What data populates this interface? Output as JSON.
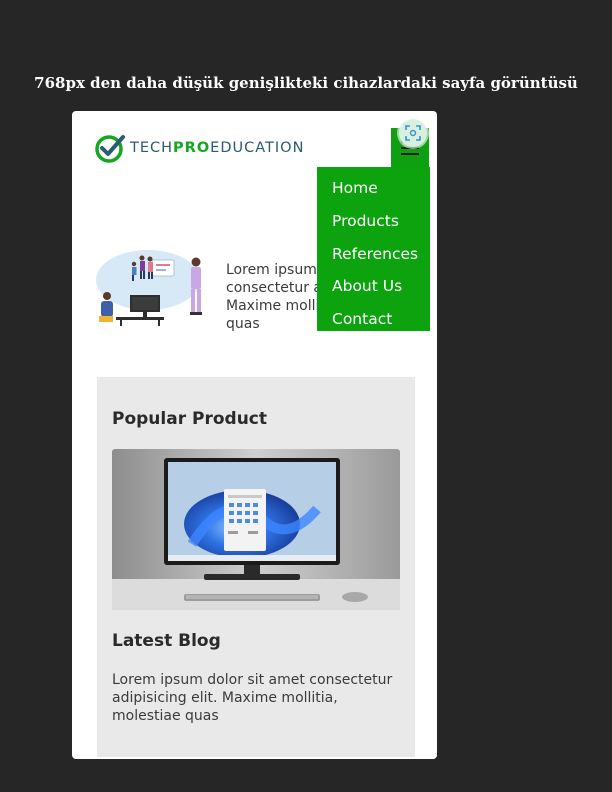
{
  "caption": "768px den daha düşük genişlikteki cihazlardaki sayfa görüntüsü",
  "logo": {
    "part1": "TECH",
    "part2": "PRO",
    "part3": "EDUCATION"
  },
  "colors": {
    "accent": "#0ca30f",
    "page_bg": "#262626",
    "card_bg": "#e9e9e9"
  },
  "icons": {
    "menu": "hamburger-icon",
    "logo": "check-circle-icon",
    "overlay": "scan-icon"
  },
  "menu": {
    "items": [
      {
        "label": "Home"
      },
      {
        "label": "Products"
      },
      {
        "label": "References"
      },
      {
        "label": "About Us"
      },
      {
        "label": "Contact"
      }
    ]
  },
  "hero": {
    "text": "Lorem ipsum dolor sit amet consectetur adipisicing elit. Maxime mollitia, molestiae quas"
  },
  "product": {
    "title": "Popular Product"
  },
  "blog": {
    "title": "Latest Blog",
    "text": "Lorem ipsum dolor sit amet consectetur adipisicing elit. Maxime mollitia, molestiae quas"
  }
}
